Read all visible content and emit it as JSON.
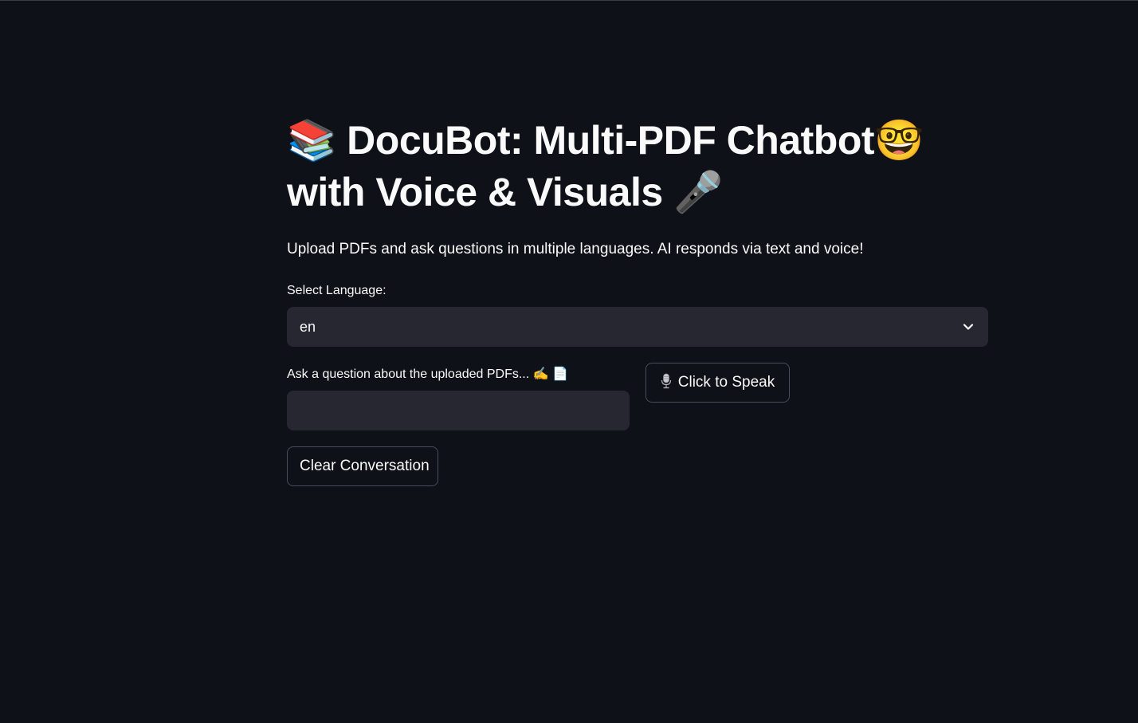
{
  "header": {
    "title_emoji_left": "📚",
    "title_text": "DocuBot: Multi-PDF Chatbot",
    "title_emoji_mid": "🤓",
    "title_text_2": "with Voice & Visuals",
    "title_emoji_right": "🎤"
  },
  "subtitle": "Upload PDFs and ask questions in multiple languages. AI responds via text and voice!",
  "language": {
    "label": "Select Language:",
    "selected": "en"
  },
  "question": {
    "label": "Ask a question about the uploaded PDFs... ✍️ 📄",
    "value": "",
    "placeholder": ""
  },
  "buttons": {
    "speak_label": "Click to Speak",
    "speak_icon": "microphone-icon",
    "clear_label": "Clear Conversation"
  },
  "colors": {
    "background": "#0e1117",
    "input_background": "#262730",
    "text": "#fafafa",
    "button_border": "#4a4d55"
  }
}
